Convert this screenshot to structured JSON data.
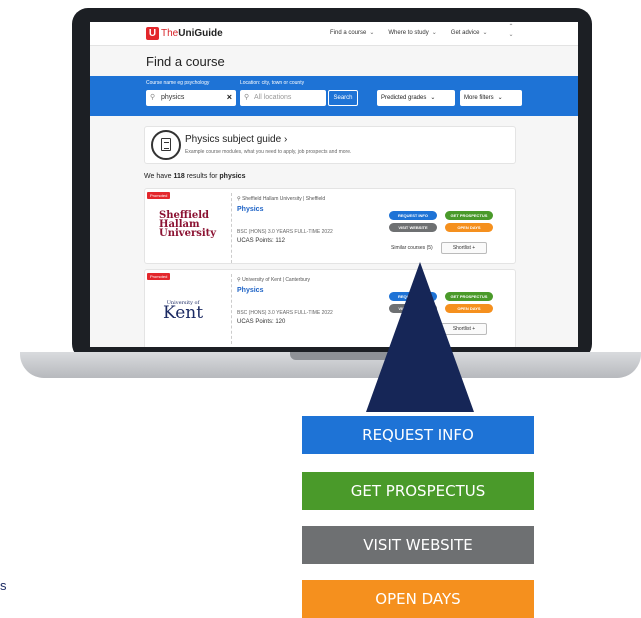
{
  "header": {
    "logo_mark": "U",
    "logo_prefix": "The",
    "logo_brand": "UniGuide",
    "nav": [
      "Find a course",
      "Where to study",
      "Get advice"
    ]
  },
  "page": {
    "title": "Find a course"
  },
  "search": {
    "course_label": "Course name eg psychology",
    "course_value": "physics",
    "location_label": "Location: city, town or county",
    "location_placeholder": "All locations",
    "search_button": "Search",
    "grades_button": "Predicted grades",
    "filters_button": "More filters"
  },
  "guide": {
    "title": "Physics subject guide ›",
    "subtitle": "Example course modules, what you need to apply, job prospects and more."
  },
  "results": {
    "prefix": "We have",
    "count": "118",
    "middle": "results for",
    "term": "physics"
  },
  "cards": [
    {
      "promoted": "Promoted",
      "uni_logo": [
        "Sheffield",
        "Hallam",
        "University"
      ],
      "location": "Sheffield Hallam University | Sheffield",
      "course": "Physics",
      "meta": "BSC (HONS) 3.0 YEARS FULL-TIME 2022",
      "ucas": "UCAS Points: 112",
      "similar": "Similar courses (5)",
      "shortlist": "Shortlist +"
    },
    {
      "promoted": "Promoted",
      "uni_logo": [
        "University of",
        "Kent"
      ],
      "location": "University of Kent | Canterbury",
      "course": "Physics",
      "meta": "BSC (HONS) 3.0 YEARS FULL-TIME 2022",
      "ucas": "UCAS Points: 120",
      "shortlist": "Shortlist +"
    }
  ],
  "ctas": {
    "request": "REQUEST INFO",
    "prospectus": "GET PROSPECTUS",
    "website": "VISIT WEBSITE",
    "open_days": "OPEN DAYS"
  },
  "callout": {
    "request": "REQUEST INFO",
    "prospectus": "GET PROSPECTUS",
    "website": "VISIT WEBSITE",
    "open_days": "OPEN DAYS"
  },
  "stray_text": "s",
  "colors": {
    "accent_blue": "#1e73d6",
    "prospectus_green": "#4a9a2a",
    "website_grey": "#6e7072",
    "opendays_orange": "#f5901e",
    "brand_red": "#e3262b",
    "arrow_navy": "#162657"
  }
}
